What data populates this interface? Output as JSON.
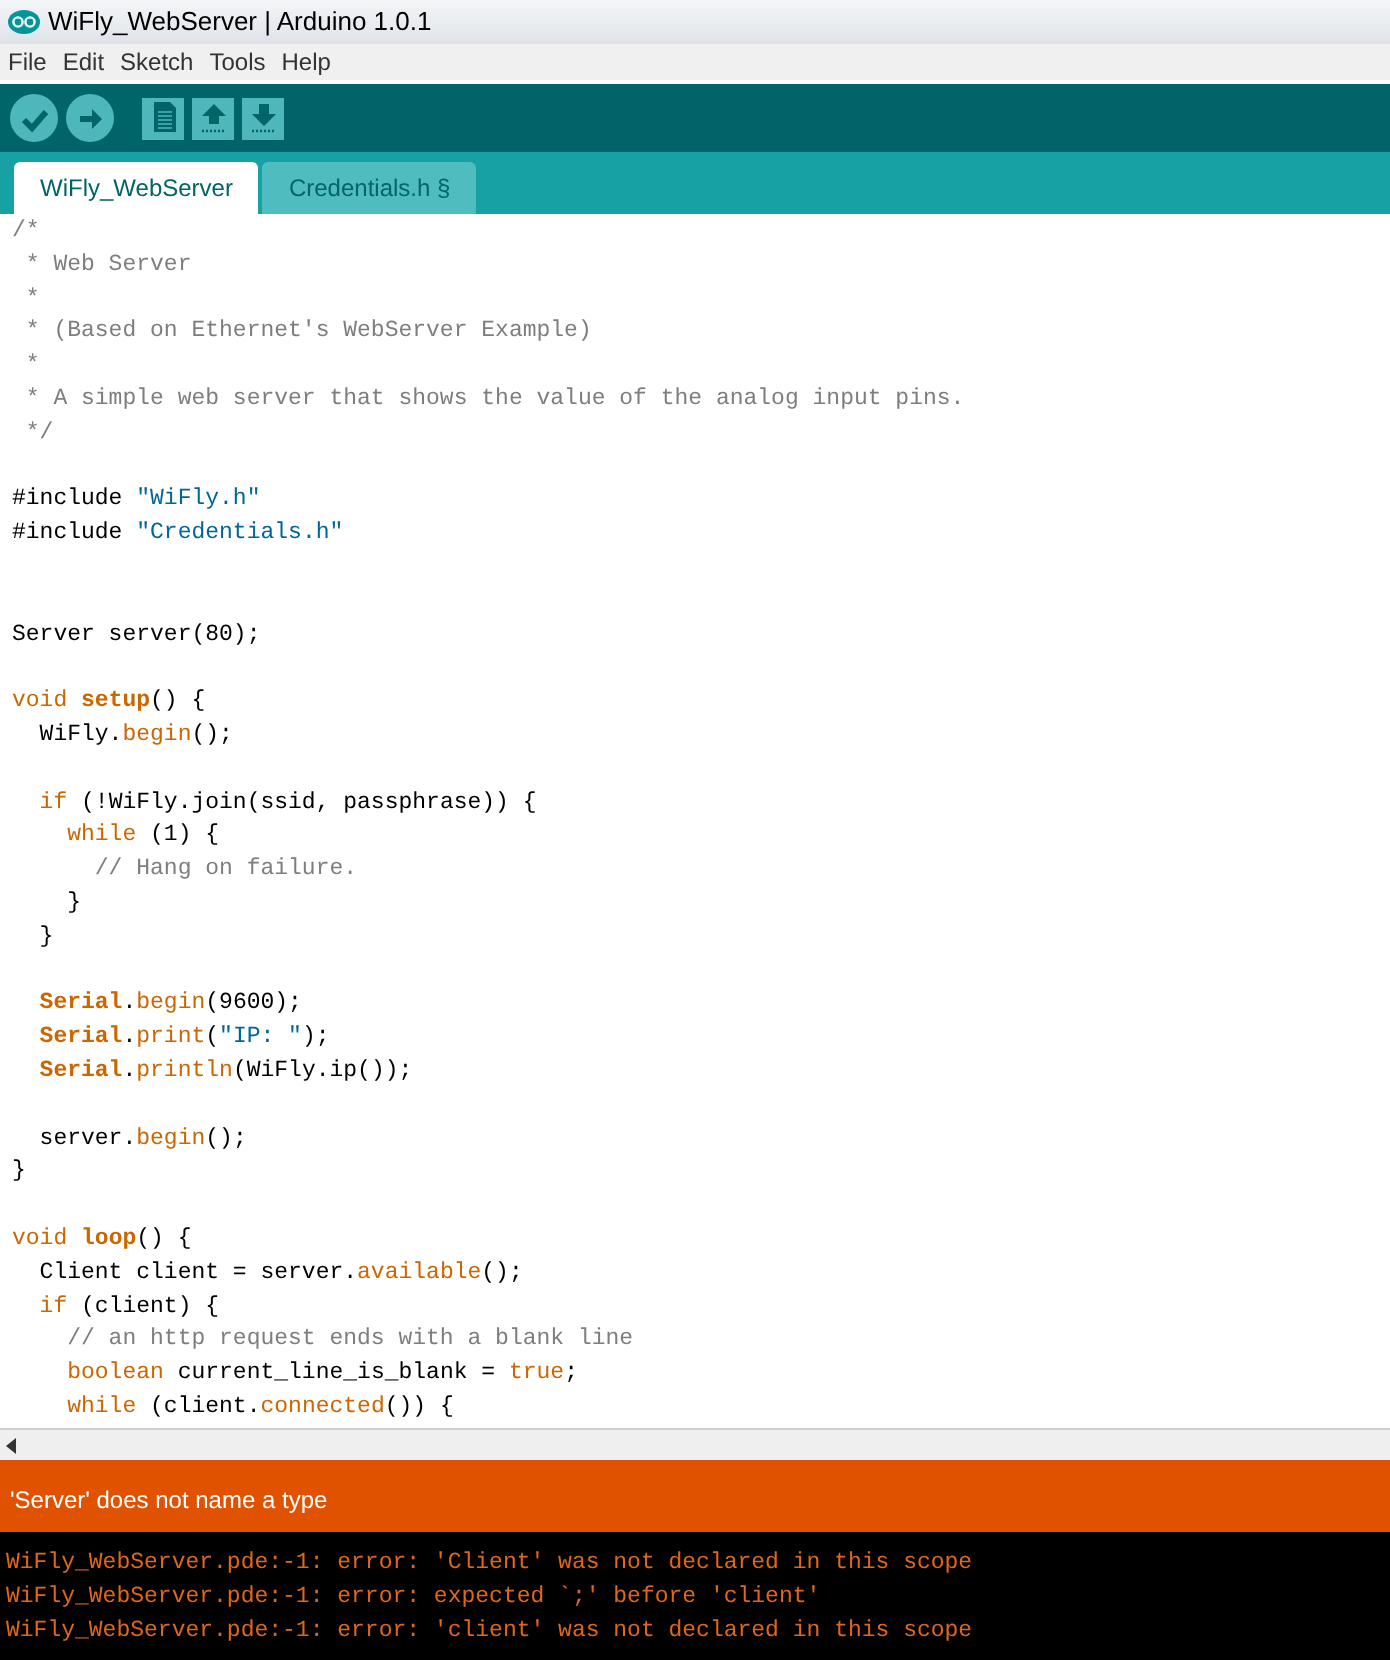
{
  "window": {
    "title": "WiFly_WebServer | Arduino 1.0.1"
  },
  "menu": [
    "File",
    "Edit",
    "Sketch",
    "Tools",
    "Help"
  ],
  "toolbar": [
    {
      "kind": "verify"
    },
    {
      "kind": "upload"
    },
    {
      "kind": "new"
    },
    {
      "kind": "open"
    },
    {
      "kind": "save"
    }
  ],
  "tabs": [
    {
      "label": "WiFly_WebServer",
      "selected": true
    },
    {
      "label": "Credentials.h §",
      "selected": false
    }
  ],
  "editor": {
    "lines": [
      {
        "kind": "code",
        "tokens": [
          {
            "kind": "cm",
            "text": "/*"
          }
        ]
      },
      {
        "kind": "code",
        "tokens": [
          {
            "kind": "cm",
            "text": " * Web Server"
          }
        ]
      },
      {
        "kind": "code",
        "tokens": [
          {
            "kind": "cm",
            "text": " *"
          }
        ]
      },
      {
        "kind": "code",
        "tokens": [
          {
            "kind": "cm",
            "text": " * (Based on Ethernet's WebServer Example)"
          }
        ]
      },
      {
        "kind": "code",
        "tokens": [
          {
            "kind": "cm",
            "text": " *"
          }
        ]
      },
      {
        "kind": "code",
        "tokens": [
          {
            "kind": "cm",
            "text": " * A simple web server that shows the value of the analog input pins."
          }
        ]
      },
      {
        "kind": "code",
        "tokens": [
          {
            "kind": "cm",
            "text": " */"
          }
        ]
      },
      {
        "kind": "blank"
      },
      {
        "kind": "code",
        "tokens": [
          {
            "kind": "plain",
            "text": "#include "
          },
          {
            "kind": "str",
            "text": "\"WiFly.h\""
          }
        ]
      },
      {
        "kind": "code",
        "tokens": [
          {
            "kind": "plain",
            "text": "#include "
          },
          {
            "kind": "str",
            "text": "\"Credentials.h\""
          }
        ]
      },
      {
        "kind": "blank"
      },
      {
        "kind": "blank"
      },
      {
        "kind": "code",
        "tokens": [
          {
            "kind": "plain",
            "text": "Server server(80);"
          }
        ]
      },
      {
        "kind": "blank"
      },
      {
        "kind": "code",
        "tokens": [
          {
            "kind": "kw",
            "text": "void"
          },
          {
            "kind": "bold",
            "text": " setup"
          },
          {
            "kind": "plain",
            "text": "() {"
          }
        ]
      },
      {
        "kind": "code",
        "tokens": [
          {
            "kind": "plain",
            "text": "  WiFly."
          },
          {
            "kind": "kw",
            "text": "begin"
          },
          {
            "kind": "plain",
            "text": "();"
          }
        ]
      },
      {
        "kind": "blank"
      },
      {
        "kind": "code",
        "tokens": [
          {
            "kind": "kw",
            "text": "  if"
          },
          {
            "kind": "plain",
            "text": " (!WiFly.join(ssid, passphrase)) {"
          }
        ]
      },
      {
        "kind": "code",
        "tokens": [
          {
            "kind": "kw",
            "text": "    while"
          },
          {
            "kind": "plain",
            "text": " (1) {"
          }
        ]
      },
      {
        "kind": "code",
        "tokens": [
          {
            "kind": "cm",
            "text": "      // Hang on failure."
          }
        ]
      },
      {
        "kind": "code",
        "tokens": [
          {
            "kind": "plain",
            "text": "    }"
          }
        ]
      },
      {
        "kind": "code",
        "tokens": [
          {
            "kind": "plain",
            "text": "  }"
          }
        ]
      },
      {
        "kind": "blank"
      },
      {
        "kind": "code",
        "tokens": [
          {
            "kind": "bold",
            "text": "  Serial"
          },
          {
            "kind": "plain",
            "text": "."
          },
          {
            "kind": "kw",
            "text": "begin"
          },
          {
            "kind": "plain",
            "text": "(9600);"
          }
        ]
      },
      {
        "kind": "code",
        "tokens": [
          {
            "kind": "bold",
            "text": "  Serial"
          },
          {
            "kind": "plain",
            "text": "."
          },
          {
            "kind": "kw",
            "text": "print"
          },
          {
            "kind": "plain",
            "text": "("
          },
          {
            "kind": "str",
            "text": "\"IP: \""
          },
          {
            "kind": "plain",
            "text": ");"
          }
        ]
      },
      {
        "kind": "code",
        "tokens": [
          {
            "kind": "bold",
            "text": "  Serial"
          },
          {
            "kind": "plain",
            "text": "."
          },
          {
            "kind": "kw",
            "text": "println"
          },
          {
            "kind": "plain",
            "text": "(WiFly.ip());"
          }
        ]
      },
      {
        "kind": "blank"
      },
      {
        "kind": "code",
        "tokens": [
          {
            "kind": "plain",
            "text": "  server."
          },
          {
            "kind": "kw",
            "text": "begin"
          },
          {
            "kind": "plain",
            "text": "();"
          }
        ]
      },
      {
        "kind": "code",
        "tokens": [
          {
            "kind": "plain",
            "text": "}"
          }
        ]
      },
      {
        "kind": "blank"
      },
      {
        "kind": "code",
        "tokens": [
          {
            "kind": "kw",
            "text": "void"
          },
          {
            "kind": "bold",
            "text": " loop"
          },
          {
            "kind": "plain",
            "text": "() {"
          }
        ]
      },
      {
        "kind": "code",
        "tokens": [
          {
            "kind": "plain",
            "text": "  Client client = server."
          },
          {
            "kind": "kw",
            "text": "available"
          },
          {
            "kind": "plain",
            "text": "();"
          }
        ]
      },
      {
        "kind": "code",
        "tokens": [
          {
            "kind": "kw",
            "text": "  if"
          },
          {
            "kind": "plain",
            "text": " (client) {"
          }
        ]
      },
      {
        "kind": "code",
        "tokens": [
          {
            "kind": "cm",
            "text": "    // an http request ends with a blank line"
          }
        ]
      },
      {
        "kind": "code",
        "tokens": [
          {
            "kind": "kw",
            "text": "    boolean"
          },
          {
            "kind": "plain",
            "text": " current_line_is_blank = "
          },
          {
            "kind": "kw",
            "text": "true"
          },
          {
            "kind": "plain",
            "text": ";"
          }
        ]
      },
      {
        "kind": "code",
        "tokens": [
          {
            "kind": "kw",
            "text": "    while"
          },
          {
            "kind": "plain",
            "text": " (client."
          },
          {
            "kind": "kw",
            "text": "connected"
          },
          {
            "kind": "plain",
            "text": "()) {"
          }
        ]
      }
    ]
  },
  "status": {
    "message": "'Server' does not name a type"
  },
  "console": [
    "WiFly_WebServer.pde:-1: error: 'Client' was not declared in this scope",
    "WiFly_WebServer.pde:-1: error: expected `;' before 'client'",
    "WiFly_WebServer.pde:-1: error: 'client' was not declared in this scope"
  ]
}
